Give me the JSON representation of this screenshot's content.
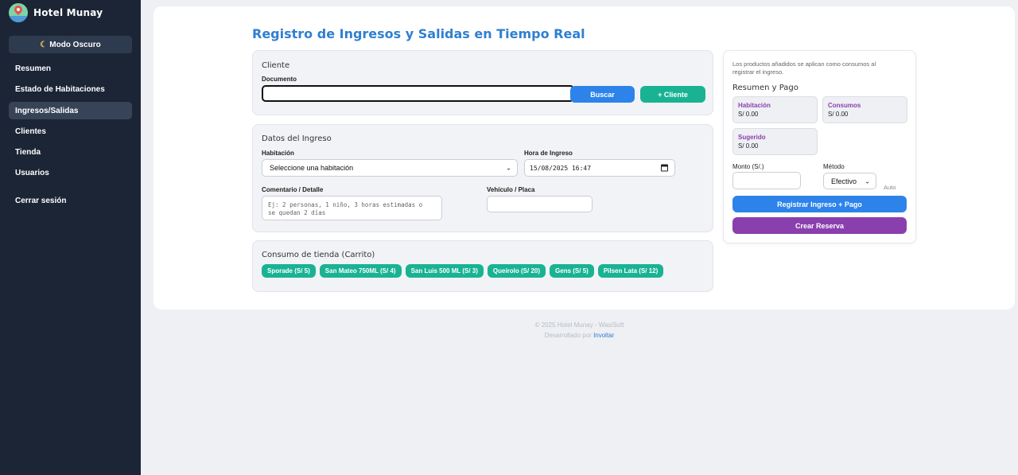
{
  "sidebar": {
    "brand": "Hotel Munay",
    "dark_mode_icon": "moon-icon",
    "dark_mode_label": "Modo Oscuro",
    "items": [
      {
        "label": "Resumen"
      },
      {
        "label": "Estado de Habitaciones"
      },
      {
        "label": "Ingresos/Salidas",
        "active": true
      },
      {
        "label": "Clientes"
      },
      {
        "label": "Tienda"
      },
      {
        "label": "Usuarios"
      },
      {
        "label": "Cerrar sesión"
      }
    ]
  },
  "page": {
    "title": "Registro de Ingresos y Salidas en Tiempo Real"
  },
  "cliente": {
    "title": "Cliente",
    "documento_label": "Documento",
    "documento_value": "",
    "buscar_label": "Buscar",
    "nuevo_cliente_label": "+ Cliente"
  },
  "ingreso": {
    "title": "Datos del Ingreso",
    "habitacion_label": "Habitación",
    "habitacion_value": "Seleccione una habitación",
    "hora_label": "Hora de Ingreso",
    "hora_value": "15/08/2025  16:47",
    "comentario_label": "Comentario / Detalle",
    "comentario_placeholder": "Ej: 2 personas, 1 niño, 3 horas estimadas o\nse quedan 2 días",
    "vehiculo_label": "Vehículo / Placa",
    "vehiculo_value": ""
  },
  "tienda": {
    "title": "Consumo de tienda (Carrito)",
    "products": [
      {
        "label": "Sporade (S/ 5)"
      },
      {
        "label": "San Mateo 750ML (S/ 4)"
      },
      {
        "label": "San Luis 500 ML (S/ 3)"
      },
      {
        "label": "Queirolo (S/ 20)"
      },
      {
        "label": "Gens (S/ 5)"
      },
      {
        "label": "Pilsen Lata (S/ 12)"
      }
    ]
  },
  "resumen": {
    "note": "Los productos añadidos se aplican como consumos al registrar el ingreso.",
    "title": "Resumen y Pago",
    "habitacion_label": "Habitación",
    "habitacion_value": "S/ 0.00",
    "consumos_label": "Consumos",
    "consumos_value": "S/ 0.00",
    "sugerido_label": "Sugerido",
    "sugerido_value": "S/ 0.00",
    "monto_label": "Monto (S/.)",
    "monto_value": "",
    "metodo_label": "Método",
    "metodo_value": "Efectivo",
    "auto_label": "Auto",
    "registrar_label": "Registrar Ingreso + Pago",
    "reserva_label": "Crear Reserva"
  },
  "footer": {
    "copyright": "© 2025 Hotel Munay - WasiSoft",
    "dev_prefix": "Desarrollado por",
    "dev_link": "Involtar"
  },
  "colors": {
    "sidebar_bg": "#1c2536",
    "accent_blue": "#2d83ea",
    "accent_green": "#19b394",
    "accent_purple": "#8a3fae",
    "title_blue": "#2f7fd1"
  }
}
